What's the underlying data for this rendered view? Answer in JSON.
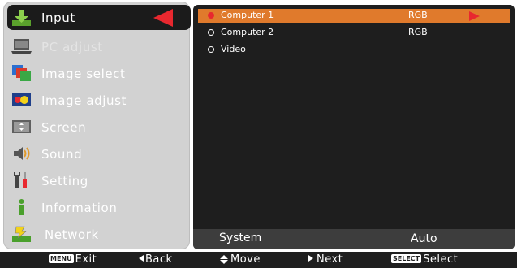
{
  "menu": {
    "items": [
      {
        "label": "Input",
        "icon": "input-download-icon"
      },
      {
        "label": "PC adjust",
        "icon": "laptop-icon"
      },
      {
        "label": "Image select",
        "icon": "image-select-icon"
      },
      {
        "label": "Image adjust",
        "icon": "image-adjust-icon"
      },
      {
        "label": "Screen",
        "icon": "screen-icon"
      },
      {
        "label": "Sound",
        "icon": "speaker-icon"
      },
      {
        "label": "Setting",
        "icon": "tools-icon"
      },
      {
        "label": "Information",
        "icon": "info-icon"
      },
      {
        "label": "Network",
        "icon": "network-icon"
      }
    ]
  },
  "input_list": [
    {
      "name": "Computer 1",
      "signal": "RGB",
      "selected": true
    },
    {
      "name": "Computer 2",
      "signal": "RGB",
      "selected": false
    },
    {
      "name": "Video",
      "signal": "",
      "selected": false
    }
  ],
  "system": {
    "label": "System",
    "value": "Auto"
  },
  "guide": {
    "exit_badge": "MENU",
    "exit": "Exit",
    "back": "Back",
    "move": "Move",
    "next": "Next",
    "select_badge": "SELECT",
    "select": "Select"
  },
  "colors": {
    "highlight": "#e07a2c",
    "accent_red": "#e8282f",
    "menu_bg": "#d2d2d2",
    "panel_bg": "#1e1e1e"
  }
}
